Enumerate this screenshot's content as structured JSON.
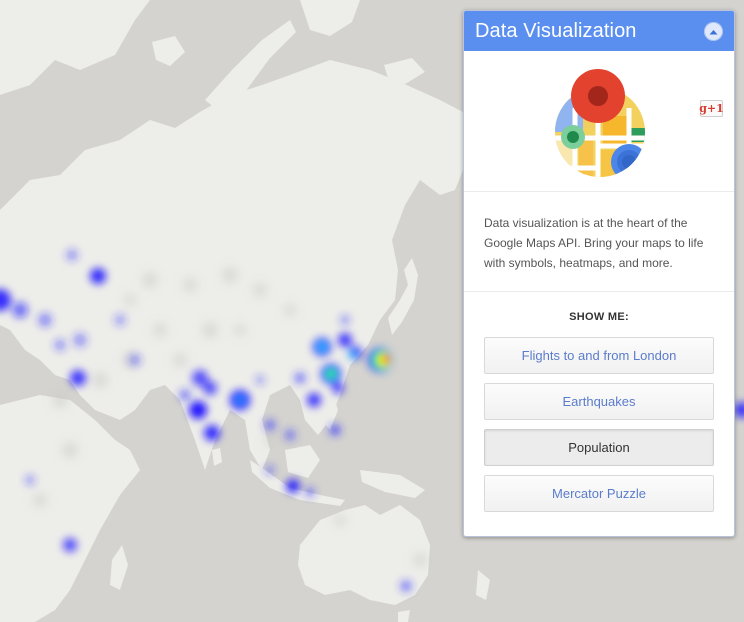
{
  "map": {
    "land_color": "#ededea",
    "water_color": "#d4d3cf",
    "heat_colors": [
      "#1a12ff",
      "#39f",
      "#3f3",
      "#ff0",
      "#f00"
    ]
  },
  "panel": {
    "title": "Data Visualization",
    "collapse_icon": "chevron-up-icon",
    "gplus_label": "g+1",
    "description": "Data visualization is at the heart of the Google Maps API. Bring your maps to life with symbols, heatmaps, and more.",
    "show_me_label": "SHOW ME:",
    "buttons": [
      {
        "label": "Flights to and from London",
        "active": false
      },
      {
        "label": "Earthquakes",
        "active": false
      },
      {
        "label": "Population",
        "active": true
      },
      {
        "label": "Mercator Puzzle",
        "active": false
      }
    ],
    "accent_color": "#5a8ff0"
  }
}
